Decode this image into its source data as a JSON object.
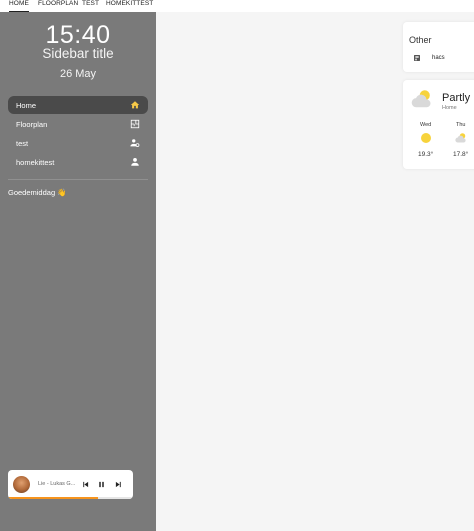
{
  "tabs": [
    {
      "label": "HOME",
      "active": true
    },
    {
      "label": "FLOORPLAN",
      "active": false
    },
    {
      "label": "TEST",
      "active": false
    },
    {
      "label": "HOMEKITTEST",
      "active": false
    }
  ],
  "sidebar": {
    "clock": "15:40",
    "title": "Sidebar title",
    "date": "26 May",
    "menu": [
      {
        "label": "Home",
        "icon": "home-icon",
        "active": true
      },
      {
        "label": "Floorplan",
        "icon": "floorplan-icon",
        "active": false
      },
      {
        "label": "test",
        "icon": "account-cog-icon",
        "active": false
      },
      {
        "label": "homekittest",
        "icon": "account-icon",
        "active": false
      }
    ],
    "greeting": "Goedemiddag 👋"
  },
  "player": {
    "track": "Lie - Lukas G...",
    "progress": 0.72
  },
  "other_card": {
    "title": "Other",
    "item_label": "hacs"
  },
  "weather_card": {
    "state": "Partly",
    "location": "Home",
    "forecast": [
      {
        "day": "Wed",
        "temp": "19.3°",
        "icon": "sunny-icon"
      },
      {
        "day": "Thu",
        "temp": "17.8°",
        "icon": "partly-cloudy-icon"
      }
    ]
  },
  "colors": {
    "sidebar_bg": "#7a7a7a",
    "active_item_bg": "#4a4a4a",
    "home_icon": "#f7c948",
    "progress": "#f7941d",
    "sun": "#f7d33c"
  }
}
